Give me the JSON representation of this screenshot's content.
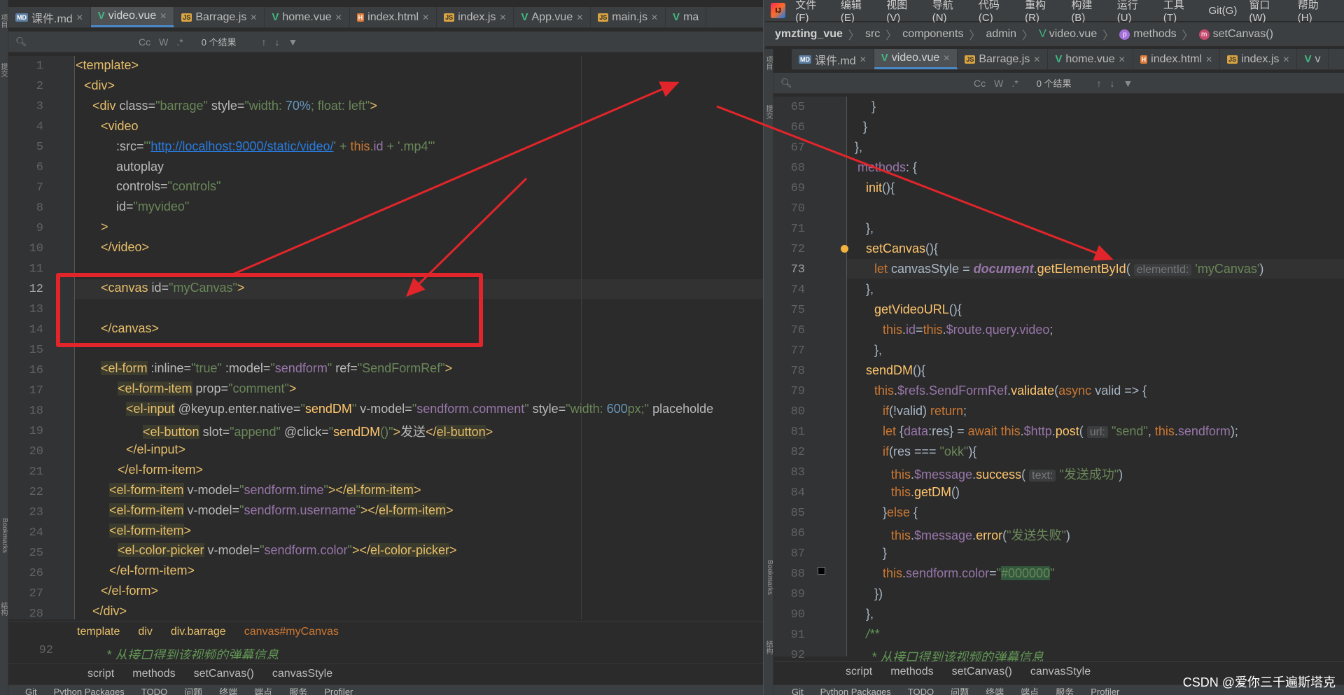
{
  "left_editor": {
    "tabs": [
      {
        "label": "课件.md",
        "type": "md"
      },
      {
        "label": "video.vue",
        "type": "vue",
        "active": true
      },
      {
        "label": "Barrage.js",
        "type": "js"
      },
      {
        "label": "home.vue",
        "type": "vue"
      },
      {
        "label": "index.html",
        "type": "html"
      },
      {
        "label": "index.js",
        "type": "js"
      },
      {
        "label": "App.vue",
        "type": "vue"
      },
      {
        "label": "main.js",
        "type": "js"
      },
      {
        "label": "ma",
        "type": "vue"
      }
    ],
    "search": {
      "result_text": "0 个结果",
      "toolbar": [
        "Cc",
        "W",
        ".*"
      ]
    },
    "line_numbers": [
      "1",
      "2",
      "3",
      "4",
      "5",
      "6",
      "7",
      "8",
      "9",
      "10",
      "11",
      "12",
      "13",
      "14",
      "15",
      "16",
      "17",
      "18",
      "19",
      "20",
      "21",
      "22",
      "23",
      "24",
      "25",
      "26",
      "27",
      "28"
    ],
    "breadcrumb": [
      "template",
      "div",
      "div.barrage",
      "canvas#myCanvas"
    ],
    "lower_line_number": "92",
    "lower_comment": "* 从接口得到该视频的弹幕信息",
    "lower_breadcrumb": [
      "script",
      "methods",
      "setCanvas()",
      "canvasStyle"
    ],
    "tool_windows": [
      "Git",
      "Python Packages",
      "TODO",
      "问题",
      "终端",
      "端点",
      "服务",
      "Profiler"
    ]
  },
  "left_sidebar_labels": [
    "项目",
    "提交",
    "Bookmarks",
    "结构"
  ],
  "right_editor": {
    "menu": [
      "文件(F)",
      "编辑(E)",
      "视图(V)",
      "导航(N)",
      "代码(C)",
      "重构(R)",
      "构建(B)",
      "运行(U)",
      "工具(T)",
      "Git(G)",
      "窗口(W)",
      "帮助(H)"
    ],
    "path": [
      "ymzting_vue",
      "src",
      "components",
      "admin",
      "video.vue",
      "methods",
      "setCanvas()"
    ],
    "tabs": [
      {
        "label": "课件.md",
        "type": "md"
      },
      {
        "label": "video.vue",
        "type": "vue",
        "active": true
      },
      {
        "label": "Barrage.js",
        "type": "js"
      },
      {
        "label": "home.vue",
        "type": "vue"
      },
      {
        "label": "index.html",
        "type": "html"
      },
      {
        "label": "index.js",
        "type": "js"
      },
      {
        "label": "v",
        "type": "vue"
      }
    ],
    "search": {
      "result_text": "0 个结果"
    },
    "line_numbers": [
      "65",
      "66",
      "67",
      "68",
      "69",
      "70",
      "71",
      "72",
      "73",
      "74",
      "75",
      "76",
      "77",
      "78",
      "79",
      "80",
      "81",
      "82",
      "83",
      "84",
      "85",
      "86",
      "87",
      "88",
      "89",
      "90",
      "91",
      "92"
    ],
    "breadcrumb": [
      "script",
      "methods",
      "setCanvas()",
      "canvasStyle"
    ],
    "tool_windows": [
      "Git",
      "Python Packages",
      "TODO",
      "问题",
      "终端",
      "端点",
      "服务",
      "Profiler"
    ]
  },
  "right_sidebar_labels": [
    "项目",
    "提交",
    "Bookmarks",
    "结构"
  ],
  "watermark": "CSDN @爱你三千遍斯塔克",
  "colors": {
    "annotation_red": "#e2252a",
    "accent_tab": "#4a88c7"
  }
}
